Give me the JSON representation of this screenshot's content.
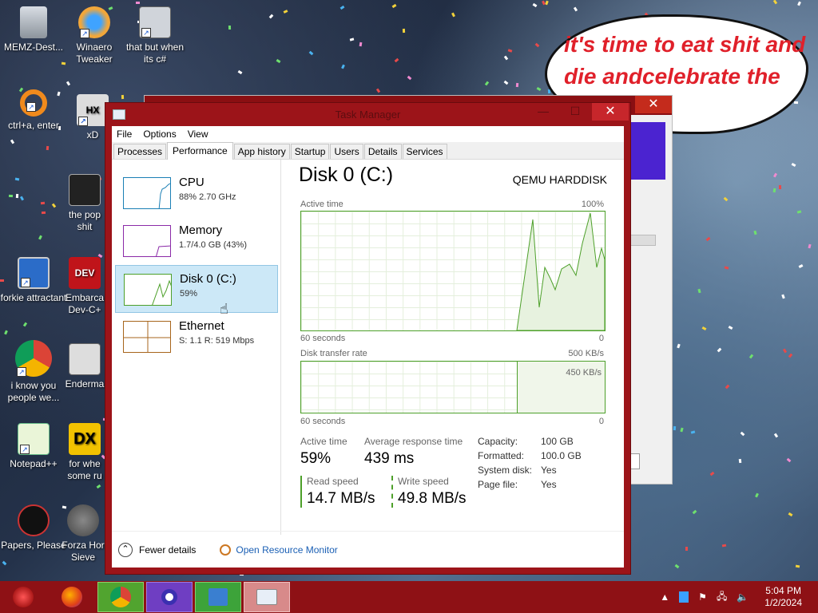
{
  "desktop": {
    "icons": [
      {
        "label": "MEMZ-Dest..."
      },
      {
        "label": "Winaero Tweaker"
      },
      {
        "label": "that but when its c#"
      },
      {
        "label": "ctrl+a, enter"
      },
      {
        "label": "xD"
      },
      {
        "label": "the pop shit"
      },
      {
        "label": "forkie attractant"
      },
      {
        "label": "Embarca Dev-C+"
      },
      {
        "label": "i know you people we..."
      },
      {
        "label": "Enderma"
      },
      {
        "label": "Notepad++"
      },
      {
        "label": "for whe some ru"
      },
      {
        "label": "Papers, Please"
      },
      {
        "label": "Forza Hor Sieve"
      }
    ],
    "bubble_text": "it's time to eat shit and die andcelebrate the new year"
  },
  "task_manager": {
    "title": "Task Manager",
    "menu": [
      "File",
      "Options",
      "View"
    ],
    "tabs": [
      "Processes",
      "Performance",
      "App history",
      "Startup",
      "Users",
      "Details",
      "Services"
    ],
    "active_tab": "Performance",
    "resources": [
      {
        "name": "CPU",
        "value": "88% 2.70 GHz",
        "color": "#1a7fb5"
      },
      {
        "name": "Memory",
        "value": "1.7/4.0 GB (43%)",
        "color": "#8b2aa8"
      },
      {
        "name": "Disk 0 (C:)",
        "value": "59%",
        "color": "#4da02a",
        "selected": true
      },
      {
        "name": "Ethernet",
        "value": "S: 1.1  R: 519 Mbps",
        "color": "#a7651c"
      }
    ],
    "detail": {
      "title": "Disk 0 (C:)",
      "model": "QEMU HARDDISK",
      "graph1_label": "Active time",
      "graph1_max": "100%",
      "graph1_time": "60 seconds",
      "graph1_min": "0",
      "graph2_label": "Disk transfer rate",
      "graph2_max": "500 KB/s",
      "graph2_mid": "450 KB/s",
      "graph2_time": "60 seconds",
      "graph2_min": "0",
      "active_time_label": "Active time",
      "active_time_value": "59%",
      "avg_resp_label": "Average response time",
      "avg_resp_value": "439 ms",
      "read_label": "Read speed",
      "read_value": "14.7 MB/s",
      "write_label": "Write speed",
      "write_value": "49.8 MB/s",
      "kv": [
        {
          "k": "Capacity:",
          "v": "100 GB"
        },
        {
          "k": "Formatted:",
          "v": "100.0 GB"
        },
        {
          "k": "System disk:",
          "v": "Yes"
        },
        {
          "k": "Page file:",
          "v": "Yes"
        }
      ]
    },
    "footer": {
      "fewer_details": "Fewer details",
      "open_rm": "Open Resource Monitor"
    }
  },
  "taskbar": {
    "time": "5:04 PM",
    "date": "1/2/2024"
  }
}
